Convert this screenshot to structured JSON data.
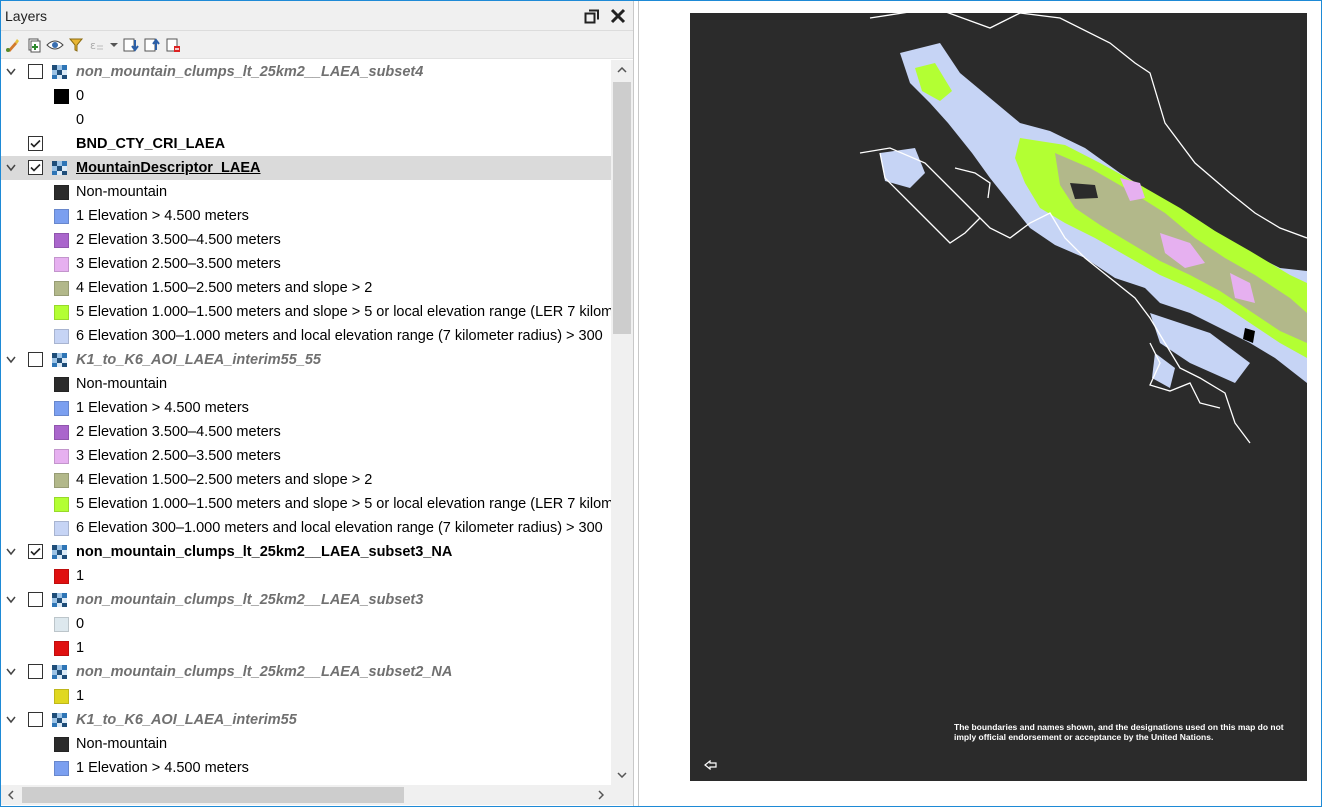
{
  "panel": {
    "title": "Layers",
    "title_buttons": [
      "restore-icon",
      "close-icon"
    ],
    "toolbar_icons": [
      "open-layer-styling-icon",
      "add-group-icon",
      "manage-visibility-icon",
      "filter-legend-icon",
      "expression-filter-icon",
      "expand-all-icon",
      "collapse-all-icon",
      "remove-layer-icon"
    ]
  },
  "colors": {
    "non_mountain": "#2b2b2b",
    "elev1": "#7b9ff0",
    "elev2": "#aa66cc",
    "elev3": "#e6b0f0",
    "elev4": "#b2b88a",
    "elev5": "#b3ff33",
    "elev6": "#c6d4f5",
    "zero_black": "#000000",
    "zero_light": "#dde8ee",
    "one_red": "#e01010",
    "one_yellow": "#e0d820",
    "map_bg": "#2b2b2b"
  },
  "layers": [
    {
      "name": "non_mountain_clumps_lt_25km2__LAEA_subset4",
      "checked": false,
      "expanded": true,
      "legend": [
        {
          "label": "0",
          "color": "#000000"
        },
        {
          "label": "0",
          "color": ""
        }
      ]
    },
    {
      "name": "BND_CTY_CRI_LAEA",
      "checked": true,
      "expanded": false,
      "legend": []
    },
    {
      "name": "MountainDescriptor_LAEA",
      "checked": true,
      "expanded": true,
      "selected": true,
      "legend": [
        {
          "label": "Non-mountain",
          "color": "#2b2b2b"
        },
        {
          "label": "1 Elevation > 4.500 meters",
          "color": "#7b9ff0"
        },
        {
          "label": "2 Elevation 3.500–4.500 meters",
          "color": "#aa66cc"
        },
        {
          "label": "3 Elevation 2.500–3.500 meters",
          "color": "#e6b0f0"
        },
        {
          "label": "4 Elevation 1.500–2.500 meters and slope > 2",
          "color": "#b2b88a"
        },
        {
          "label": "5 Elevation 1.000–1.500 meters and slope > 5 or local elevation range (LER 7 kilom",
          "color": "#b3ff33"
        },
        {
          "label": "6 Elevation 300–1.000 meters and local elevation range (7 kilometer radius) > 300",
          "color": "#c6d4f5"
        }
      ]
    },
    {
      "name": "K1_to_K6_AOI_LAEA_interim55_55",
      "checked": false,
      "expanded": true,
      "legend": [
        {
          "label": "Non-mountain",
          "color": "#2b2b2b"
        },
        {
          "label": "1 Elevation > 4.500 meters",
          "color": "#7b9ff0"
        },
        {
          "label": "2 Elevation 3.500–4.500 meters",
          "color": "#aa66cc"
        },
        {
          "label": "3 Elevation 2.500–3.500 meters",
          "color": "#e6b0f0"
        },
        {
          "label": "4 Elevation 1.500–2.500 meters and slope > 2",
          "color": "#b2b88a"
        },
        {
          "label": "5 Elevation 1.000–1.500 meters and slope > 5 or local elevation range (LER 7 kilom",
          "color": "#b3ff33"
        },
        {
          "label": "6 Elevation 300–1.000 meters and local elevation range (7 kilometer radius) > 300",
          "color": "#c6d4f5"
        }
      ]
    },
    {
      "name": "non_mountain_clumps_lt_25km2__LAEA_subset3_NA",
      "checked": true,
      "expanded": true,
      "legend": [
        {
          "label": "1",
          "color": "#e01010"
        }
      ]
    },
    {
      "name": "non_mountain_clumps_lt_25km2__LAEA_subset3",
      "checked": false,
      "expanded": true,
      "legend": [
        {
          "label": "0",
          "color": "#dde8ee"
        },
        {
          "label": "1",
          "color": "#e01010"
        }
      ]
    },
    {
      "name": "non_mountain_clumps_lt_25km2__LAEA_subset2_NA",
      "checked": false,
      "expanded": true,
      "legend": [
        {
          "label": "1",
          "color": "#e0d820"
        }
      ]
    },
    {
      "name": "K1_to_K6_AOI_LAEA_interim55",
      "checked": false,
      "expanded": true,
      "legend": [
        {
          "label": "Non-mountain",
          "color": "#2b2b2b"
        },
        {
          "label": "1 Elevation > 4.500 meters",
          "color": "#7b9ff0"
        }
      ]
    }
  ],
  "map": {
    "disclaimer": "The boundaries and names shown, and the designations used on this map do not imply official endorsement or acceptance by the United Nations."
  }
}
